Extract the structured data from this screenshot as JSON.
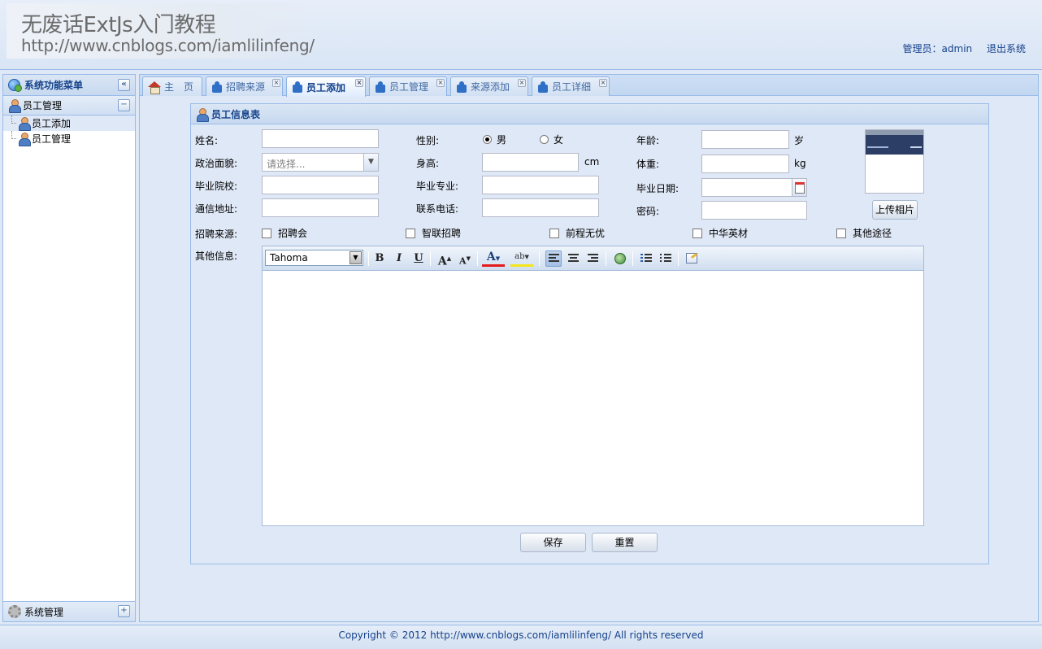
{
  "header": {
    "title": "无废话ExtJs入门教程",
    "url": "http://www.cnblogs.com/iamlilinfeng/",
    "admin_label": "管理员：admin",
    "logout": "退出系统"
  },
  "sidebar": {
    "title": "系统功能菜单",
    "collapse_icon": "double-chevron-left-icon",
    "section": "员工管理",
    "items": [
      {
        "label": "员工添加",
        "selected": true
      },
      {
        "label": "员工管理",
        "selected": false
      }
    ],
    "bottom_section": "系统管理"
  },
  "tabs": [
    {
      "label": "主　页",
      "icon": "home-icon",
      "closable": false,
      "active": false
    },
    {
      "label": "招聘来源",
      "icon": "puzzle-icon",
      "closable": true,
      "active": false
    },
    {
      "label": "员工添加",
      "icon": "puzzle-icon",
      "closable": true,
      "active": true
    },
    {
      "label": "员工管理",
      "icon": "puzzle-icon",
      "closable": true,
      "active": false
    },
    {
      "label": "来源添加",
      "icon": "puzzle-icon",
      "closable": true,
      "active": false
    },
    {
      "label": "员工详细",
      "icon": "puzzle-icon",
      "closable": true,
      "active": false
    }
  ],
  "form": {
    "title": "员工信息表",
    "labels": {
      "name": "姓名:",
      "gender": "性别:",
      "age": "年龄:",
      "political": "政治面貌:",
      "height": "身高:",
      "weight": "体重:",
      "school": "毕业院校:",
      "major": "毕业专业:",
      "grad_date": "毕业日期:",
      "address": "通信地址:",
      "phone": "联系电话:",
      "password": "密码:",
      "source": "招聘来源:",
      "other": "其他信息:"
    },
    "units": {
      "age": "岁",
      "height": "cm",
      "weight": "kg"
    },
    "gender_options": [
      "男",
      "女"
    ],
    "gender_selected": "男",
    "political_placeholder": "请选择...",
    "sources": [
      "招聘会",
      "智联招聘",
      "前程无优",
      "中华英材",
      "其他途径"
    ],
    "upload_button": "上传相片",
    "editor_font": "Tahoma",
    "save_button": "保存",
    "reset_button": "重置"
  },
  "footer": "Copyright © 2012 http://www.cnblogs.com/iamlilinfeng/  All rights reserved",
  "colors": {
    "accent": "#15428b",
    "panel_border": "#99bbe8",
    "background": "#dfe8f6"
  }
}
